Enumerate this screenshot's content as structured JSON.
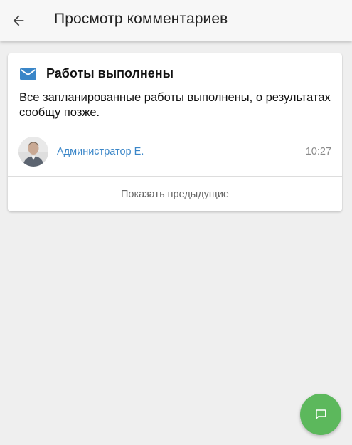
{
  "header": {
    "title": "Просмотр комментариев",
    "back_icon": "arrow-left-icon"
  },
  "comment": {
    "icon": "mail-icon",
    "icon_color": "#3a86c8",
    "title": "Работы выполнены",
    "text": "Все запланированные работы выполнены, о результатах сообщу позже.",
    "author": "Администратор Е.",
    "time": "10:27"
  },
  "show_previous_label": "Показать предыдущие",
  "fab": {
    "icon": "chat-bubble-icon",
    "color": "#5cb85c"
  }
}
